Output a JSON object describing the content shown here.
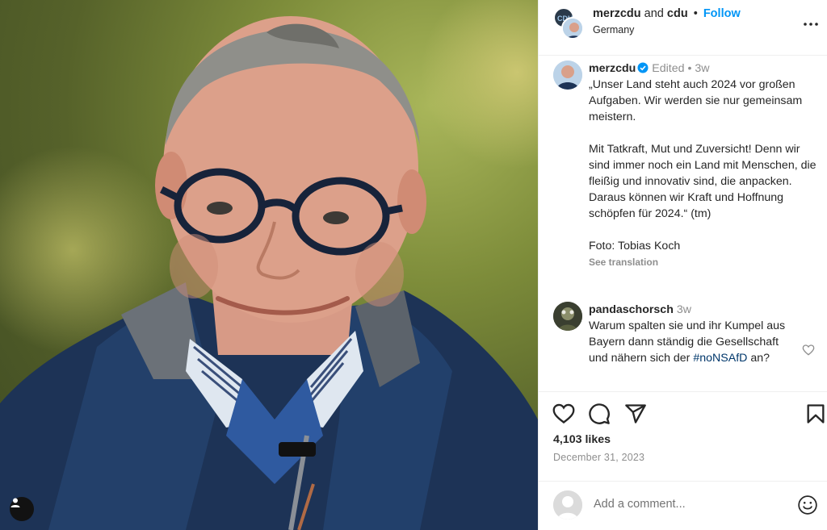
{
  "post": {
    "header": {
      "account": "merzcdu",
      "and": "and",
      "collaborator": "cdu",
      "separator": "•",
      "follow_label": "Follow",
      "location": "Germany"
    },
    "caption": {
      "user": "merzcdu",
      "edited": "Edited",
      "separator": "•",
      "age": "3w",
      "text": "„Unser Land steht auch 2024 vor großen Aufgaben. Wir werden sie nur gemeinsam meistern.\n\nMit Tatkraft, Mut und Zuversicht! Denn wir sind immer noch ein Land mit Menschen, die fleißig und innovativ sind, die anpacken. Daraus können wir Kraft und Hoffnung schöpfen für 2024.“ (tm)\n\nFoto: Tobias Koch",
      "see_translation": "See translation"
    },
    "comment": {
      "user": "pandaschorsch",
      "age": "3w",
      "text": "Warum spalten sie und ihr Kumpel aus Bayern dann ständig die Gesellschaft und nähern sich der",
      "hashtag": "#noNSAfD",
      "text_end": "an?"
    },
    "likes": "4,103 likes",
    "date": "December 31, 2023",
    "add_comment_placeholder": "Add a comment...",
    "avatar_logo_text": "CDU"
  },
  "icons": {
    "like": "heart-icon",
    "comment": "comment-icon",
    "share": "share-icon",
    "save": "bookmark-icon",
    "more": "more-icon",
    "emoji": "emoji-icon",
    "verified": "verified-badge-icon",
    "tag": "user-tag-icon"
  },
  "colors": {
    "link": "#0095f6",
    "hashtag": "#00376b",
    "muted": "#8e8e8e",
    "text": "#262626"
  }
}
